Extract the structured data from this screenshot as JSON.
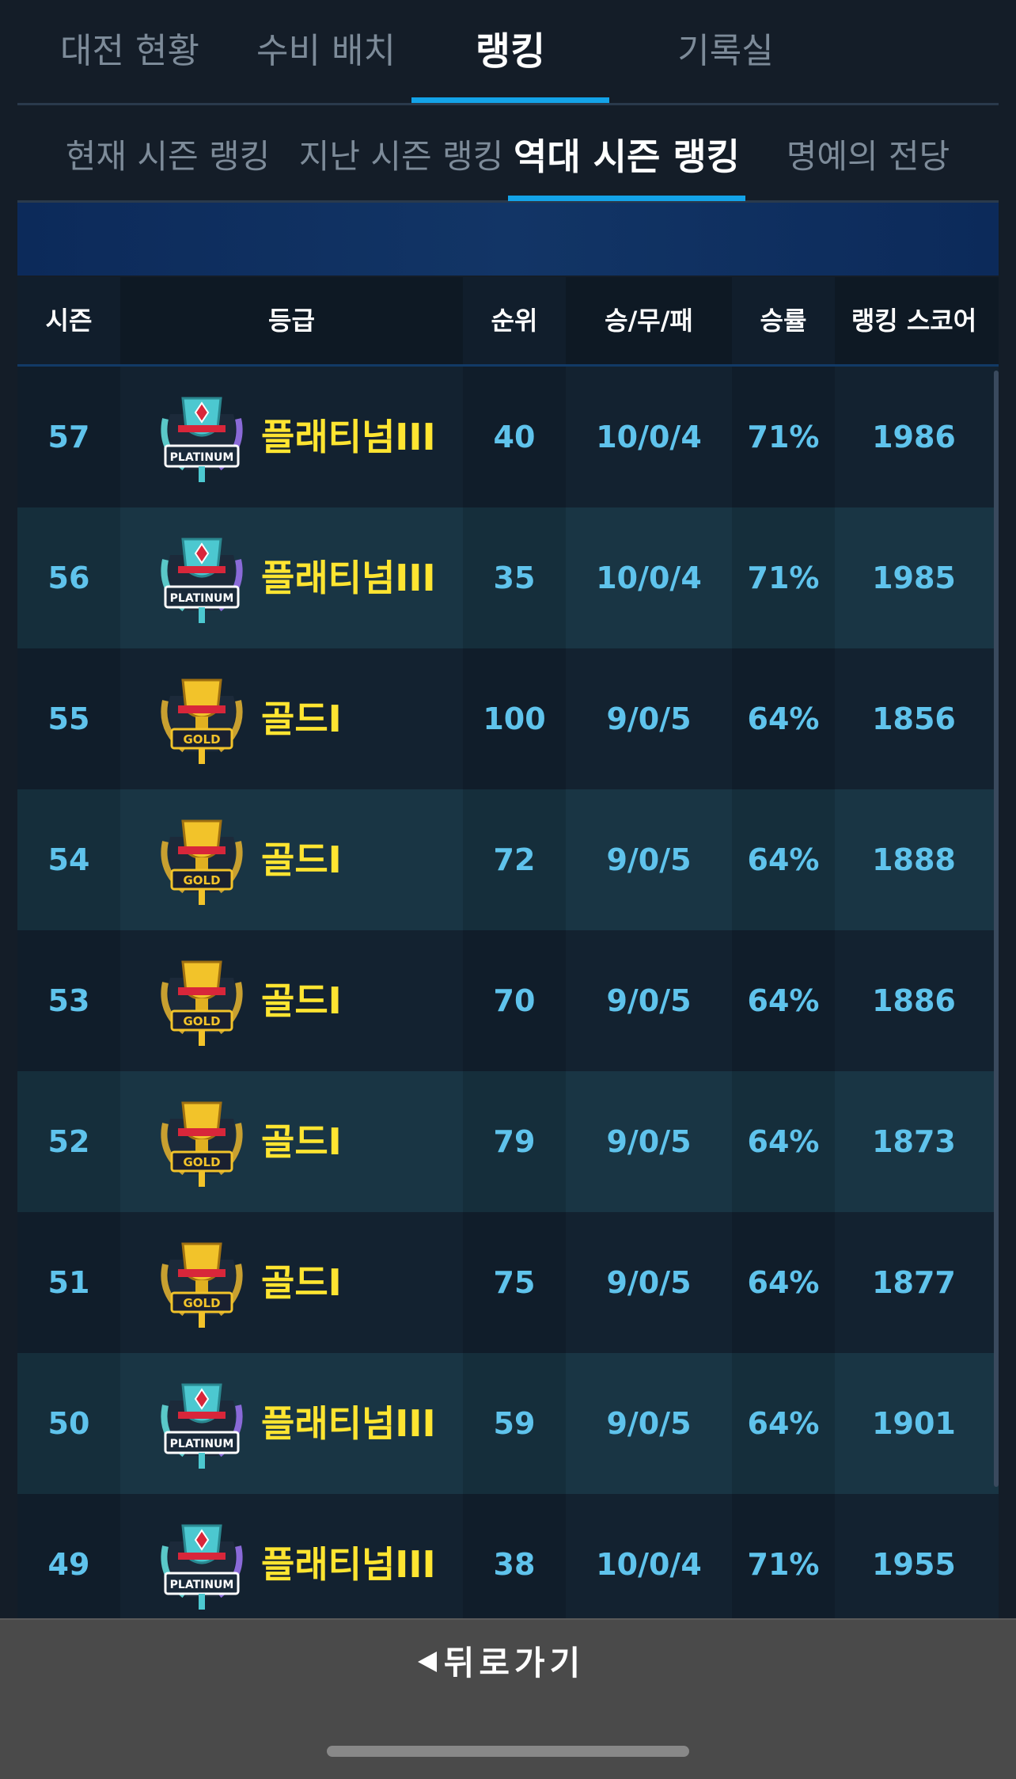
{
  "top_tabs": [
    {
      "label": "대전 현황"
    },
    {
      "label": "수비 배치"
    },
    {
      "label": "랭킹"
    },
    {
      "label": "기록실"
    }
  ],
  "sub_tabs": [
    {
      "label": "현재 시즌 랭킹"
    },
    {
      "label": "지난 시즌 랭킹"
    },
    {
      "label": "역대 시즌 랭킹"
    },
    {
      "label": "명예의 전당"
    }
  ],
  "active_top_tab": "랭킹",
  "active_sub_tab": "역대 시즌 랭킹",
  "table": {
    "headers": {
      "season": "시즌",
      "grade": "등급",
      "rank": "순위",
      "record": "승/무/패",
      "winrate": "승률",
      "score": "랭킹 스코어"
    },
    "rows": [
      {
        "season": "57",
        "badge": "platinum-badge-icon",
        "badge_label": "PLATINUM",
        "grade": "플래티넘III",
        "rank": "40",
        "record": "10/0/4",
        "winrate": "71%",
        "score": "1986"
      },
      {
        "season": "56",
        "badge": "platinum-badge-icon",
        "badge_label": "PLATINUM",
        "grade": "플래티넘III",
        "rank": "35",
        "record": "10/0/4",
        "winrate": "71%",
        "score": "1985"
      },
      {
        "season": "55",
        "badge": "gold-badge-icon",
        "badge_label": "GOLD",
        "grade": "골드I",
        "rank": "100",
        "record": "9/0/5",
        "winrate": "64%",
        "score": "1856"
      },
      {
        "season": "54",
        "badge": "gold-badge-icon",
        "badge_label": "GOLD",
        "grade": "골드I",
        "rank": "72",
        "record": "9/0/5",
        "winrate": "64%",
        "score": "1888"
      },
      {
        "season": "53",
        "badge": "gold-badge-icon",
        "badge_label": "GOLD",
        "grade": "골드I",
        "rank": "70",
        "record": "9/0/5",
        "winrate": "64%",
        "score": "1886"
      },
      {
        "season": "52",
        "badge": "gold-badge-icon",
        "badge_label": "GOLD",
        "grade": "골드I",
        "rank": "79",
        "record": "9/0/5",
        "winrate": "64%",
        "score": "1873"
      },
      {
        "season": "51",
        "badge": "gold-badge-icon",
        "badge_label": "GOLD",
        "grade": "골드I",
        "rank": "75",
        "record": "9/0/5",
        "winrate": "64%",
        "score": "1877"
      },
      {
        "season": "50",
        "badge": "platinum-badge-icon",
        "badge_label": "PLATINUM",
        "grade": "플래티넘III",
        "rank": "59",
        "record": "9/0/5",
        "winrate": "64%",
        "score": "1901"
      },
      {
        "season": "49",
        "badge": "platinum-badge-icon",
        "badge_label": "PLATINUM",
        "grade": "플래티넘III",
        "rank": "38",
        "record": "10/0/4",
        "winrate": "71%",
        "score": "1955"
      }
    ]
  },
  "footer": {
    "back_label": "뒤로가기",
    "back_icon": "back-arrow-icon"
  },
  "colors": {
    "accent": "#13a3e8",
    "grade_text": "#ffe531",
    "value_text": "#5fc3ec"
  }
}
